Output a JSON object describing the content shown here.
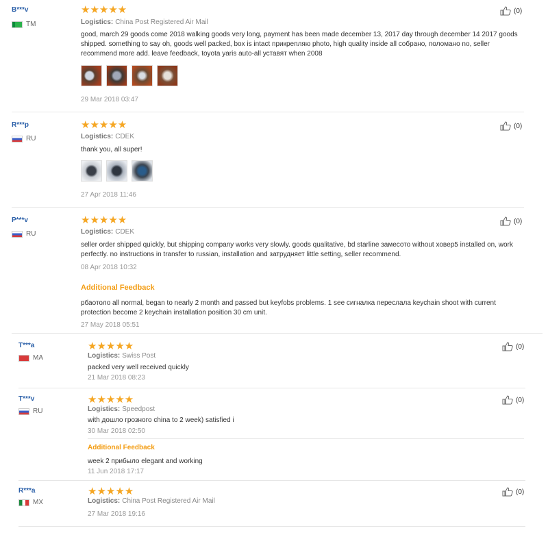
{
  "reviews": [
    {
      "user": "B***v",
      "country": "TM",
      "stars": "★★★★★",
      "logistics_label": "Logistics:",
      "logistics": "China Post Registered Air Mail",
      "text": "good, march 29 goods come 2018 walking goods very long, payment has been made december 13, 2017 day through december 14 2017 goods shipped. something to say oh, goods well packed, box is intact прикрепляю photo, high quality inside all собрано, поломано no, seller recommend more add. leave feedback, toyota yaris auto-all уставят when 2008",
      "date": "29 Mar 2018 03:47",
      "likes": "(0)"
    },
    {
      "user": "R***p",
      "country": "RU",
      "stars": "★★★★★",
      "logistics_label": "Logistics:",
      "logistics": "CDEK",
      "text": "thank you, all super!",
      "date": "27 Apr 2018 11:46",
      "likes": "(0)"
    },
    {
      "user": "P***v",
      "country": "RU",
      "stars": "★★★★★",
      "logistics_label": "Logistics:",
      "logistics": "CDEK",
      "text": "seller order shipped quickly, but shipping company works very slowly. goods qualitative, bd starline замесото without ховер5 installed on, work perfectly. no instructions in transfer to russian, installation and затрудняет little setting, seller recommend.",
      "date": "08 Apr 2018 10:32",
      "additional_label": "Additional Feedback",
      "additional_text": "рбаотоло all normal, began to nearly 2 month and passed but keyfobs problems. 1 see сигналка переслала keychain shoot with current protection become 2 keychain installation position 30 cm unit.",
      "additional_date": "27 May 2018 05:51",
      "likes": "(0)"
    },
    {
      "user": "T***a",
      "country": "MA",
      "stars": "★★★★★",
      "logistics_label": "Logistics:",
      "logistics": "Swiss Post",
      "text": "packed very well received quickly",
      "date": "21 Mar 2018 08:23",
      "likes": "(0)"
    },
    {
      "user": "T***v",
      "country": "RU",
      "stars": "★★★★★",
      "logistics_label": "Logistics:",
      "logistics": "Speedpost",
      "text": "with дошло грозного china to 2 week) satisfied i",
      "date": "30 Mar 2018 02:50",
      "additional_label": "Additional Feedback",
      "additional_text": "week 2 прибыло elegant and working",
      "additional_date": "11 Jun 2018 17:17",
      "likes": "(0)"
    },
    {
      "user": "R***a",
      "country": "MX",
      "stars": "★★★★★",
      "logistics_label": "Logistics:",
      "logistics": "China Post Registered Air Mail",
      "date": "27 Mar 2018 19:16",
      "likes": "(0)"
    }
  ],
  "colors": {
    "star": "#f5a623",
    "username": "#2a5fa8",
    "additional": "#f39c12"
  },
  "icons": {
    "like": "thumbs-up-icon"
  }
}
